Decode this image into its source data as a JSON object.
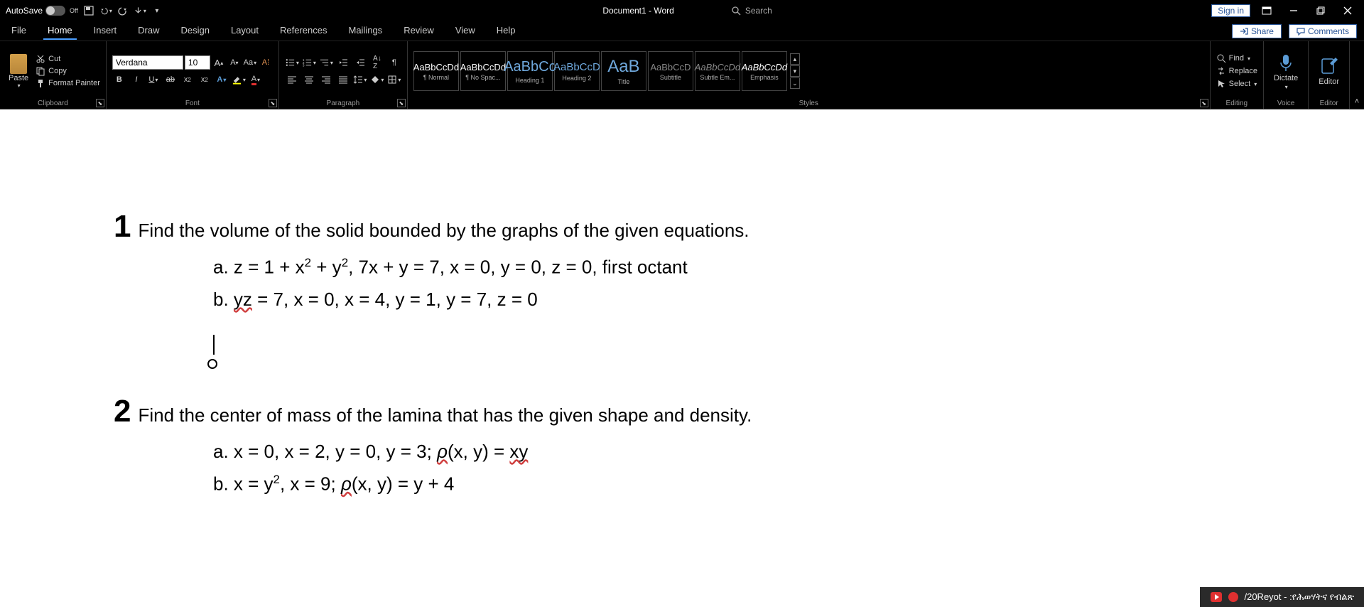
{
  "titlebar": {
    "autosave": "AutoSave",
    "autosave_state": "Off",
    "doc_title": "Document1 - Word",
    "search": "Search",
    "sign_in": "Sign in"
  },
  "tabs": {
    "file": "File",
    "home": "Home",
    "insert": "Insert",
    "draw": "Draw",
    "design": "Design",
    "layout": "Layout",
    "references": "References",
    "mailings": "Mailings",
    "review": "Review",
    "view": "View",
    "help": "Help",
    "share": "Share",
    "comments": "Comments"
  },
  "ribbon": {
    "clipboard": {
      "paste": "Paste",
      "cut": "Cut",
      "copy": "Copy",
      "format_painter": "Format Painter",
      "label": "Clipboard"
    },
    "font": {
      "name": "Verdana",
      "size": "10",
      "label": "Font"
    },
    "paragraph": {
      "label": "Paragraph"
    },
    "styles": {
      "items": [
        {
          "preview": "AaBbCcDd",
          "name": "¶ Normal"
        },
        {
          "preview": "AaBbCcDd",
          "name": "¶ No Spac..."
        },
        {
          "preview": "AaBbCc",
          "name": "Heading 1"
        },
        {
          "preview": "AaBbCcD",
          "name": "Heading 2"
        },
        {
          "preview": "AaB",
          "name": "Title"
        },
        {
          "preview": "AaBbCcD",
          "name": "Subtitle"
        },
        {
          "preview": "AaBbCcDd",
          "name": "Subtle Em..."
        },
        {
          "preview": "AaBbCcDd",
          "name": "Emphasis"
        }
      ],
      "label": "Styles"
    },
    "editing": {
      "find": "Find",
      "replace": "Replace",
      "select": "Select",
      "label": "Editing"
    },
    "voice": {
      "dictate": "Dictate",
      "label": "Voice"
    },
    "editor": {
      "editor": "Editor",
      "label": "Editor"
    }
  },
  "document": {
    "q1": "Find the volume of the solid bounded by the graphs of the given equations.",
    "q1a_pre": "a. z = 1 + x",
    "q1a_mid1": " + y",
    "q1a_post": ", 7x + y = 7, x = 0, y = 0, z = 0, first octant",
    "q1b_pre": "b. ",
    "q1b_yz": "yz",
    "q1b_post": " = 7, x = 0, x = 4, y = 1, y = 7, z = 0",
    "q2": "Find the center of mass of the lamina that has the given shape and density.",
    "q2a_pre": "a. x = 0, x = 2, y = 0, y = 3; ",
    "q2a_rho": "ρ",
    "q2a_mid": "(x, y) = ",
    "q2a_xy": "xy",
    "q2b_pre": "b. x = y",
    "q2b_mid": ", x = 9; ",
    "q2b_rho": "ρ",
    "q2b_post": "(x, y) = y + 4"
  },
  "notif": {
    "text": "/20Reyot - :የሕወሃትና የብልጽ"
  }
}
